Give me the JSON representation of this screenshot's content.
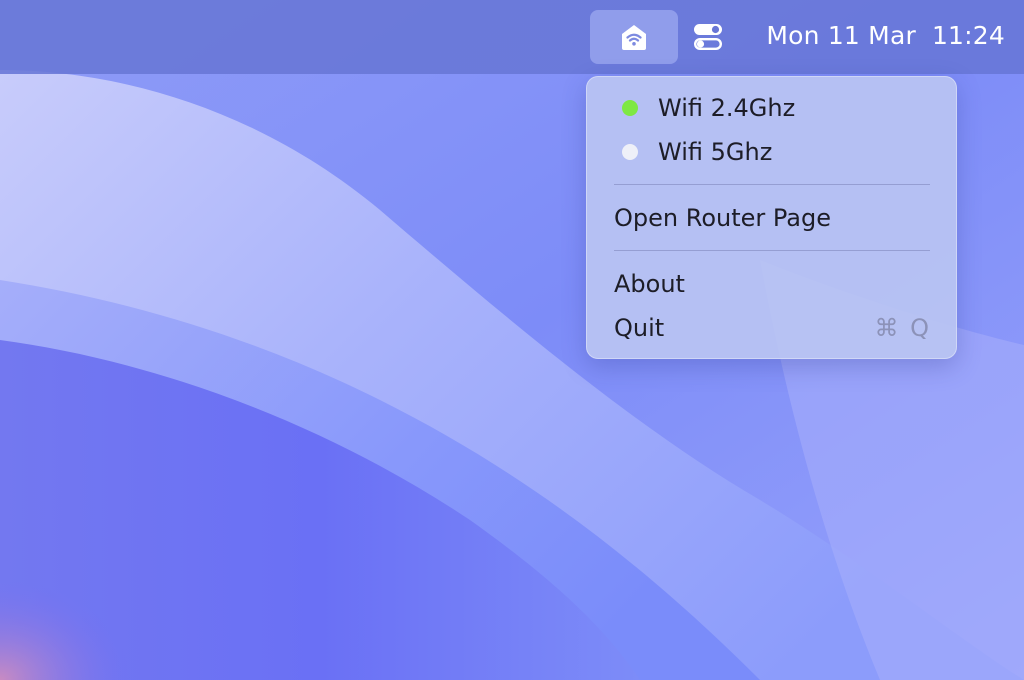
{
  "menubar": {
    "date": "Mon 11 Mar",
    "time": "11:24",
    "app_icon": "router-wifi-icon",
    "control_center_icon": "control-center-toggle-icon"
  },
  "menu": {
    "networks": [
      {
        "label": "Wifi 2.4Ghz",
        "status_color": "#7ee843",
        "active": true
      },
      {
        "label": "Wifi 5Ghz",
        "status_color": "#eef0f8",
        "active": false
      }
    ],
    "open_router_label": "Open Router Page",
    "about_label": "About",
    "quit_label": "Quit",
    "quit_shortcut": "⌘ Q"
  },
  "colors": {
    "menubar": "#6876d6",
    "menu_background": "#bac4f2",
    "accent_active": "#7ee843"
  }
}
